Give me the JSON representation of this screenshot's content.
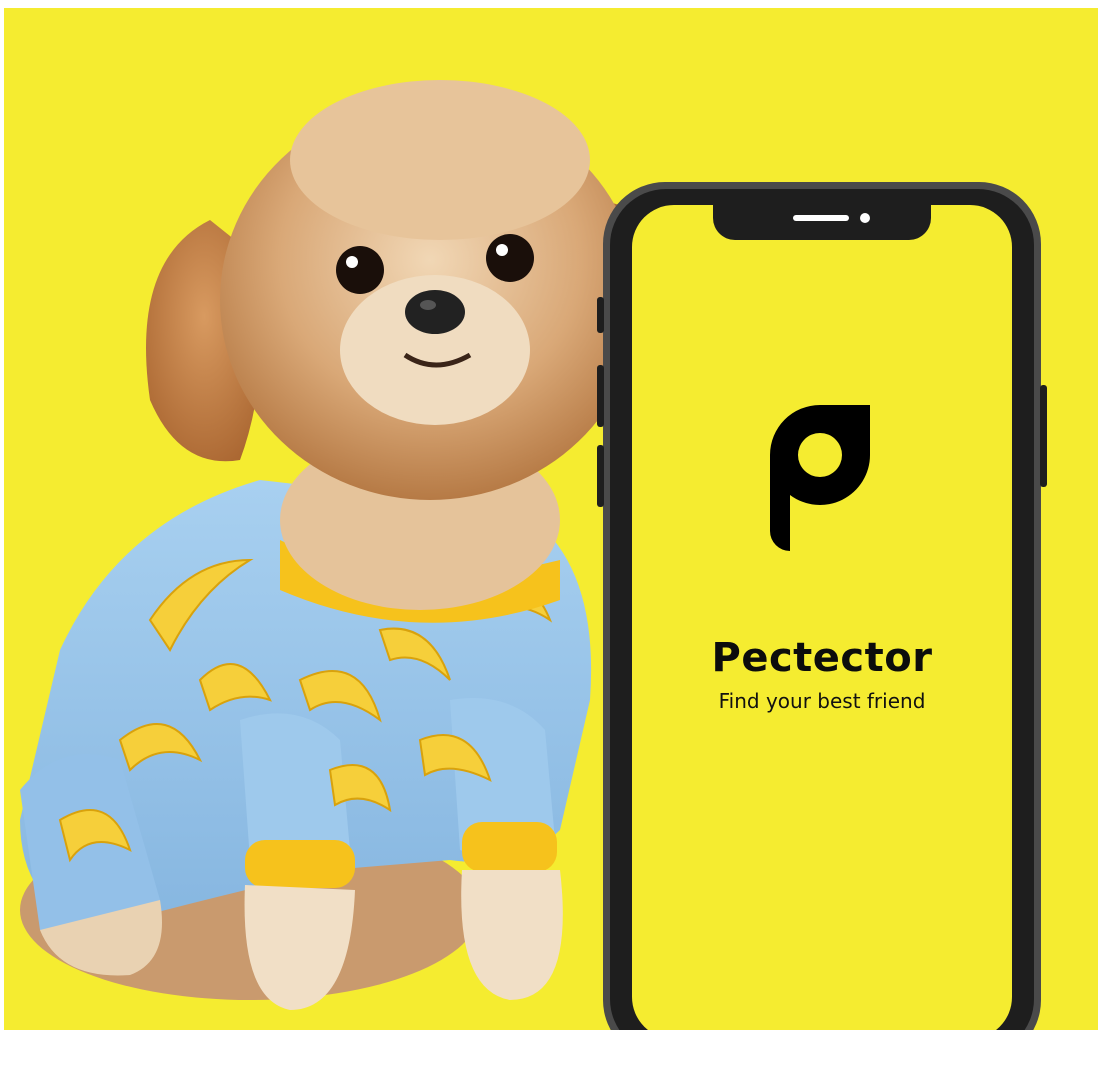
{
  "app": {
    "name": "Pectector",
    "tagline": "Find your best friend",
    "logo_icon": "p-letter-logo-icon"
  },
  "colors": {
    "background": "#f5ec30",
    "phone_frame": "#4a4a4a",
    "phone_bezel": "#1e1e1e",
    "text": "#0c0c0c",
    "sweater": "#9cc6ea",
    "sweater_trim": "#f6c21c",
    "fur": "#d9a877"
  },
  "image": {
    "subject": "dog-in-banana-sweater-photo"
  }
}
